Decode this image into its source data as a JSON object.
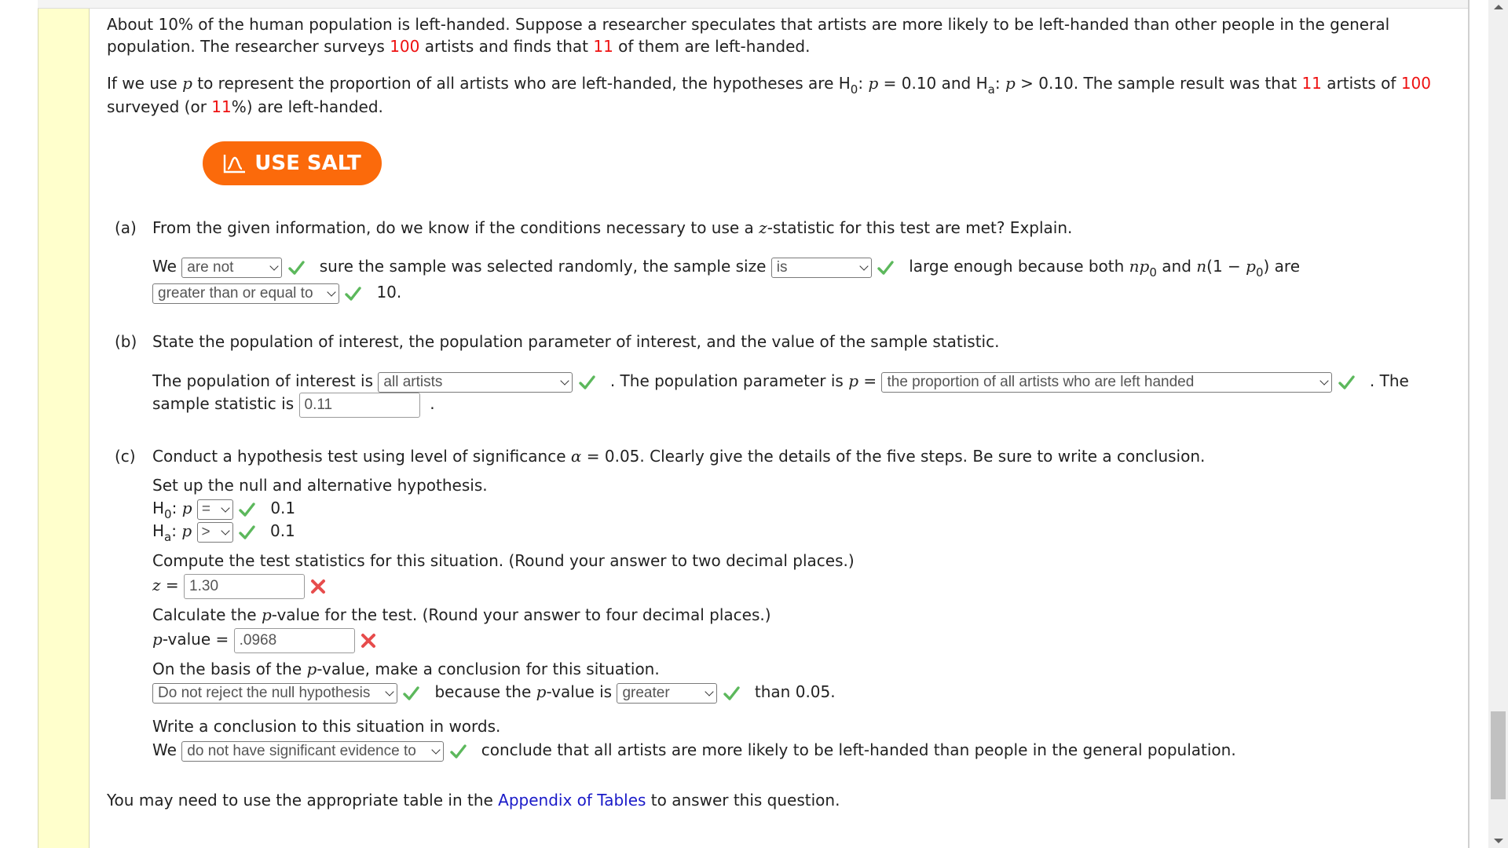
{
  "intro": {
    "p1_a": "About 10% of the human population is left-handed. Suppose a researcher speculates that artists are more likely to be left-handed than other people in the general",
    "p1_b": "population. The researcher surveys ",
    "n": "100",
    "p1_c": " artists and finds that ",
    "x": "11",
    "p1_d": " of them are left-handed.",
    "p2_a": "If we use ",
    "p_var": "p",
    "p2_b": " to represent the proportion of all artists who are left-handed, the hypotheses are H",
    "h0_sub": "0",
    "p2_c": ": ",
    "p2_d": " = 0.10 and H",
    "ha_sub": "a",
    "p2_e": ": ",
    "p2_f": " > 0.10. The sample result was that ",
    "x2": "11",
    "p2_g": " artists of ",
    "n2": "100",
    "p2_h": "surveyed (or ",
    "pct": "11",
    "p2_i": "%) are left-handed."
  },
  "salt_button": {
    "label": "USE SALT",
    "color": "#fb6a0b"
  },
  "part_a": {
    "label": "(a)",
    "question_a": "From the given information, do we know if the conditions necessary to use a ",
    "question_z": "z",
    "question_b": "-statistic for this test are met? Explain.",
    "we": "We",
    "sel1": "are not",
    "t1": "sure the sample was selected randomly, the sample size",
    "sel2": "is",
    "t2": "large enough because both ",
    "np": "np",
    "sub0": "0",
    "t3": " and ",
    "n1p": "n",
    "t4": "(1 − ",
    "p0": "p",
    "t5": ") are",
    "sel3": "greater than or equal to",
    "t6": "10."
  },
  "part_b": {
    "label": "(b)",
    "question": "State the population of interest, the population parameter of interest, and the value of the sample statistic.",
    "t1": "The population of interest is",
    "sel1": "all artists",
    "t2": ". The population parameter is ",
    "p": "p",
    "t3": " =",
    "sel2": "the proportion of all artists who are left handed",
    "t4": ". The",
    "t5": "sample statistic is",
    "input": "0.11",
    "t6": "."
  },
  "part_c": {
    "label": "(c)",
    "question_a": "Conduct a hypothesis test using level of significance ",
    "alpha": "α",
    "question_b": " = 0.05. Clearly give the details of the five steps. Be sure to write a conclusion.",
    "setup": "Set up the null and alternative hypothesis.",
    "h": "H",
    "h0_sub": "0",
    "ha_sub": "a",
    "colon_p": ": ",
    "p": "p",
    "h0_sel": "=",
    "ha_sel": ">",
    "h0_val": "0.1",
    "ha_val": "0.1",
    "compute": "Compute the test statistics for this situation. (Round your answer to two decimal places.)",
    "z": "z",
    "eq": " =",
    "z_value": "1.30",
    "calc_a": "Calculate the ",
    "calc_b": "-value for the test. (Round your answer to four decimal places.)",
    "pval_label": "-value =",
    "pval_value": ".0968",
    "basis_a": "On the basis of the ",
    "basis_b": "-value, make a conclusion for this situation.",
    "decision_sel": "Do not reject the null hypothesis",
    "because_a": "because the ",
    "because_b": "-value is",
    "compare_sel": "greater",
    "than": "than 0.05.",
    "write": "Write a conclusion to this situation in words.",
    "we": "We",
    "evidence_sel": "do not have significant evidence to",
    "conclude": "conclude that all artists are more likely to be left-handed than people in the general population."
  },
  "footer": {
    "a": "You may need to use the appropriate table in the ",
    "link": "Appendix of Tables",
    "b": " to answer this question."
  },
  "colors": {
    "correct": "#5cb85c",
    "incorrect": "#e74c4c",
    "highlight": "#ee1111",
    "link": "#1a1ac8"
  }
}
